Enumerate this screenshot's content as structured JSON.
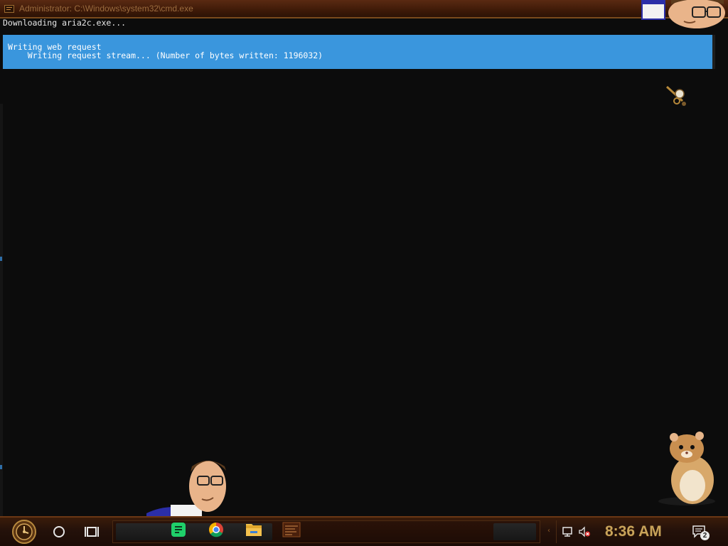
{
  "window": {
    "title": "Administrator: C:\\Windows\\system32\\cmd.exe"
  },
  "console": {
    "lines": [
      "Downloading aria2c.exe..."
    ],
    "progress": {
      "heading": "Writing web request",
      "detail": "    Writing request stream... (Number of bytes written: 1196032)"
    }
  },
  "taskbar": {
    "start_icon": "steampunk-clock-orb-icon",
    "cortana_icon": "cortana-circle-icon",
    "taskview_icon": "task-view-icon",
    "pinned_apps": [
      "notes-app-icon",
      "chrome-icon",
      "file-explorer-icon",
      "command-prompt-icon"
    ],
    "tray": {
      "chevron": "‹",
      "network_icon": "network-icon",
      "volume_icon": "volume-muted-icon",
      "clock": "8:36 AM",
      "notification_count": "2"
    }
  },
  "colors": {
    "console_bg": "#0c0c0c",
    "progress_bg": "#3a96dd",
    "title_text": "#9b6b3e",
    "clock_text": "#c8a35a",
    "taskbar_bg": "#24110a"
  }
}
